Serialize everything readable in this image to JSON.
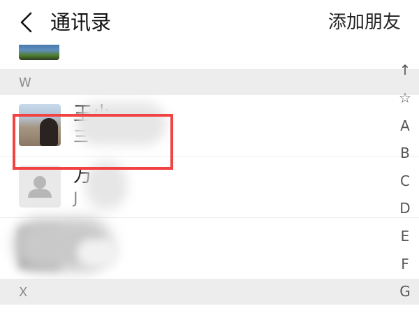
{
  "header": {
    "back_icon": "chevron-left-icon",
    "title": "通讯录",
    "add_friend": "添加朋友"
  },
  "sections": {
    "w": {
      "letter": "W"
    },
    "x": {
      "letter": "X"
    }
  },
  "contacts": [
    {
      "name": "王小",
      "sub": "三",
      "avatar": "photo-avatar"
    },
    {
      "name": "万",
      "sub": "J",
      "avatar": "default-user-icon"
    },
    {
      "name": "",
      "sub": "",
      "avatar": "photo-avatar-blurred"
    }
  ],
  "index_bar": [
    "↑",
    "☆",
    "A",
    "B",
    "C",
    "D",
    "E",
    "F",
    "G"
  ],
  "colors": {
    "highlight": "#f24343",
    "section_bg": "#ededed",
    "section_text": "#8a8a8a"
  }
}
